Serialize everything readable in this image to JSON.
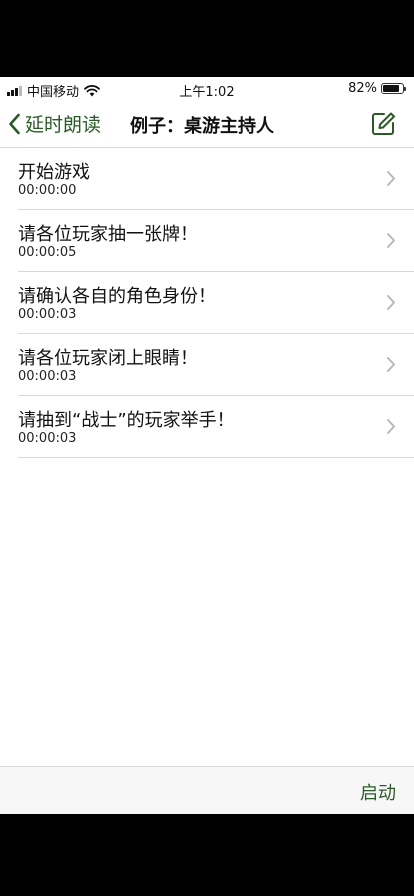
{
  "status_bar": {
    "carrier": "中国移动",
    "time": "上午1:02",
    "battery": "82%",
    "battery_level": 0.82
  },
  "nav": {
    "back_label": "延时朗读",
    "title": "例子：桌游主持人"
  },
  "items": [
    {
      "title": "开始游戏",
      "time": "00:00:00"
    },
    {
      "title": "请各位玩家抽一张牌！",
      "time": "00:00:05"
    },
    {
      "title": "请确认各自的角色身份！",
      "time": "00:00:03"
    },
    {
      "title": "请各位玩家闭上眼睛！",
      "time": "00:00:03"
    },
    {
      "title": "请抽到“战士”的玩家举手！",
      "time": "00:00:03"
    }
  ],
  "toolbar": {
    "start_label": "启动"
  },
  "colors": {
    "accent": "#2a5a25"
  },
  "icons": {
    "back": "chevron-left-icon",
    "compose": "compose-icon",
    "row": "chevron-right-icon"
  }
}
